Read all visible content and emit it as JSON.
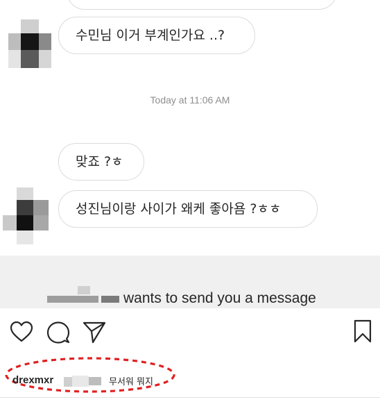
{
  "messages": [
    {
      "text": "수민님 이거 부계인가요 ..?"
    },
    {
      "text": "맞죠 ?ㅎ"
    },
    {
      "text": "성진님이랑 사이가 왜케 좋아욤 ?ㅎㅎ"
    }
  ],
  "timestamp": "Today at 11:06 AM",
  "message_request": {
    "text": "wants to send you a message"
  },
  "actions": {
    "like_icon": "heart-icon",
    "comment_icon": "comment-icon",
    "share_icon": "send-icon",
    "save_icon": "bookmark-icon"
  },
  "comment": {
    "username": "drexmxr",
    "text": "무서워 뭐지"
  },
  "colors": {
    "highlight_circle": "#e02020",
    "request_bg": "#f0f0f0",
    "bubble_border": "#dbdbdb"
  }
}
